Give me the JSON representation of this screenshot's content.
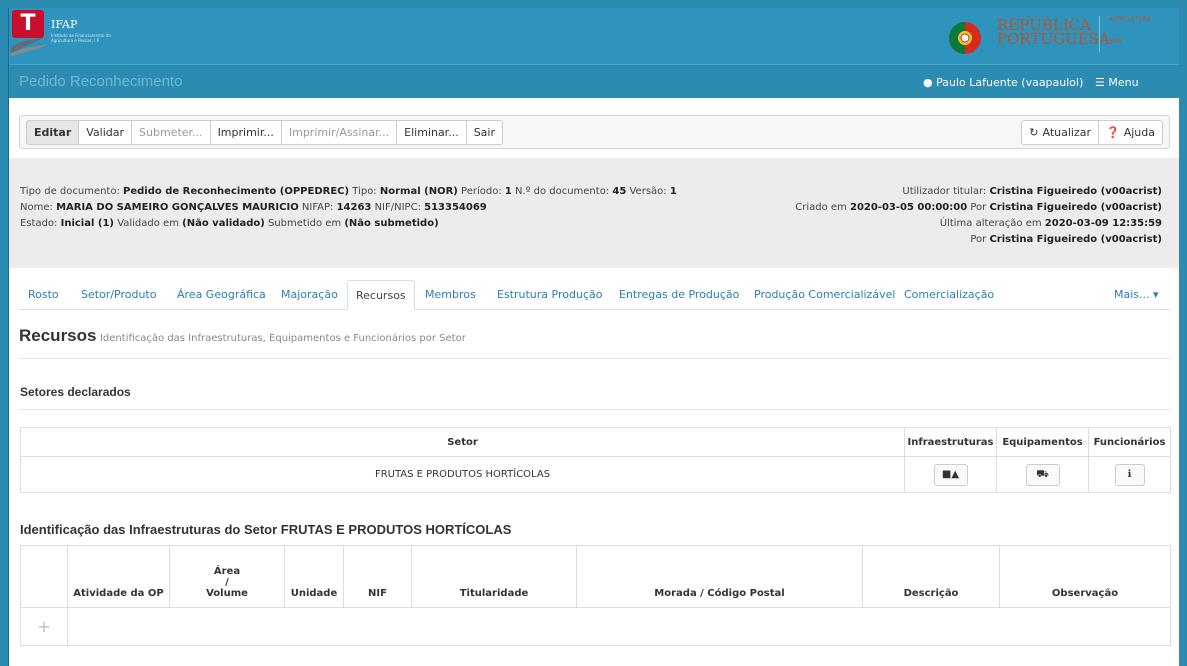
{
  "branding": {
    "logo_letter": "T",
    "logo_name": "IFAP",
    "logo_sub": "Instituto de Financiamento da Agricultura e Pescas, I.P.",
    "gov_line1": "REPÚBLICA",
    "gov_line2": "PORTUGUESA",
    "ministry_line1": "AGRICULTURA",
    "ministry_line2": "MAR"
  },
  "header": {
    "title": "Pedido Reconhecimento",
    "user": "Paulo Lafuente (vaapaulol)",
    "menu": "Menu"
  },
  "toolbar": {
    "buttons": [
      "Editar",
      "Validar",
      "Submeter...",
      "Imprimir...",
      "Imprimir/Assinar...",
      "Eliminar...",
      "Sair"
    ],
    "refresh": "Atualizar",
    "help": "Ajuda"
  },
  "info": {
    "tipo_doc_label": "Tipo de documento:",
    "tipo_doc": "Pedido de Reconhecimento (OPPEDREC)",
    "tipo_label": "Tipo:",
    "tipo": "Normal (NOR)",
    "periodo_label": "Período:",
    "periodo": "1",
    "numdoc_label": "N.º do documento:",
    "numdoc": "45",
    "versao_label": "Versão:",
    "versao": "1",
    "nome_label": "Nome:",
    "nome": "MARIA DO SAMEIRO GONÇALVES MAURICIO",
    "nifap_label": "NIFAP:",
    "nifap": "14263",
    "nif_label": "NIF/NIPC:",
    "nif": "513354069",
    "estado_label": "Estado:",
    "estado": "Inicial (1)",
    "validado_label": "Validado em",
    "validado": "(Não validado)",
    "submetido_label": "Submetido em",
    "submetido": "(Não submetido)",
    "titular_label": "Utilizador titular:",
    "titular": "Cristina Figueiredo (v00acrist)",
    "criado_label": "Criado em",
    "criado": "2020-03-05 00:00:00",
    "por_label": "Por",
    "criado_por": "Cristina Figueiredo (v00acrist)",
    "alteracao_label": "Última alteração em",
    "alteracao": "2020-03-09 12:35:59",
    "alteracao_por": "Cristina Figueiredo (v00acrist)"
  },
  "tabs": [
    "Rosto",
    "Setor/Produto",
    "Área Geográfica",
    "Majoração",
    "Recursos",
    "Membros",
    "Estrutura Produção",
    "Entregas de Produção",
    "Produção Comercializável",
    "Comercialização",
    "Mais..."
  ],
  "section": {
    "title": "Recursos",
    "subtitle": "Identificação das Infraestruturas, Equipamentos e Funcionários por Setor",
    "setores_heading": "Setores declarados",
    "infra_heading": "Identificação das Infraestruturas do Setor FRUTAS E PRODUTOS HORTÍCOLAS"
  },
  "sectors_table": {
    "headers": [
      "Setor",
      "Infraestruturas",
      "Equipamentos",
      "Funcionários"
    ],
    "rows": [
      [
        "FRUTAS E PRODUTOS HORTÍCOLAS"
      ]
    ]
  },
  "infra_table": {
    "headers": [
      "Atividade da OP",
      "Área\n/\nVolume",
      "Unidade",
      "NIF",
      "Titularidade",
      "Morada / Código Postal",
      "Descrição",
      "Observação"
    ],
    "area_l1": "Área",
    "area_l2": "/",
    "area_l3": "Volume"
  }
}
